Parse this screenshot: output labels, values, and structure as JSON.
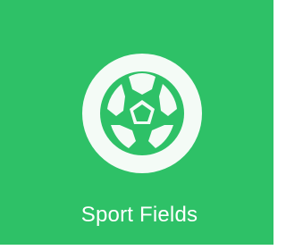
{
  "tile": {
    "label": "Sport Fields",
    "icon": "soccer-ball-icon"
  },
  "colors": {
    "tile_background": "#2ec167",
    "icon_ring": "#f4fbf6",
    "ball_background": "#2ec167",
    "ball_panels": "#f4fbf6",
    "label_text": "#ffffff",
    "page_background": "#ffffff"
  }
}
